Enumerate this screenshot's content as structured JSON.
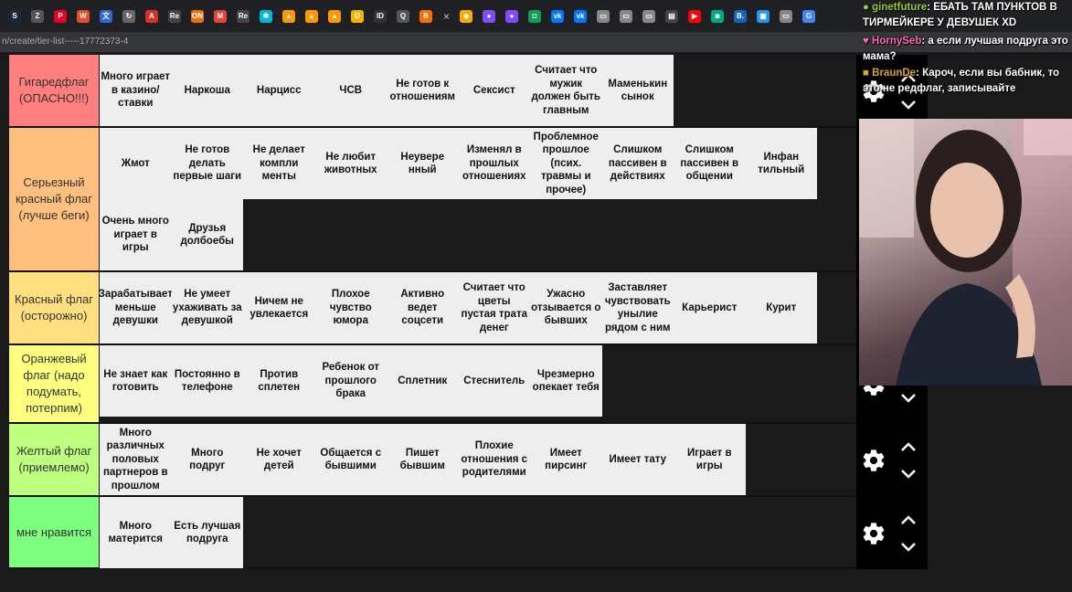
{
  "browser": {
    "tab_icons": [
      {
        "icon": "steam-icon",
        "color": "#1b2838",
        "glyph": "S"
      },
      {
        "icon": "zed-icon",
        "color": "#555555",
        "glyph": "Z"
      },
      {
        "icon": "pinterest-icon",
        "color": "#e60023",
        "glyph": "P"
      },
      {
        "icon": "w-icon",
        "color": "#e44d26",
        "glyph": "W"
      },
      {
        "icon": "translate-icon",
        "color": "#3367d6",
        "glyph": "文"
      },
      {
        "icon": "history-icon",
        "color": "#666666",
        "glyph": "↻"
      },
      {
        "icon": "a-icon",
        "color": "#d93025",
        "glyph": "A"
      },
      {
        "icon": "re-icon",
        "color": "#444444",
        "glyph": "Re"
      },
      {
        "icon": "orange-icon",
        "color": "#e8710a",
        "glyph": "ON"
      },
      {
        "icon": "gmail-icon",
        "color": "#ea4335",
        "glyph": "M"
      },
      {
        "icon": "re2-icon",
        "color": "#444444",
        "glyph": "Re"
      },
      {
        "icon": "star-icon",
        "color": "#00b8d9",
        "glyph": "✱"
      },
      {
        "icon": "fire-icon",
        "color": "#ff9800",
        "glyph": "▲"
      },
      {
        "icon": "fire2-icon",
        "color": "#ff9800",
        "glyph": "▲"
      },
      {
        "icon": "fire3-icon",
        "color": "#ff9800",
        "glyph": "▲"
      },
      {
        "icon": "d-icon",
        "color": "#f4b400",
        "glyph": "D"
      },
      {
        "icon": "id-icon",
        "color": "#333333",
        "glyph": "ID"
      },
      {
        "icon": "q-icon",
        "color": "#555555",
        "glyph": "Q"
      },
      {
        "icon": "b-icon",
        "color": "#ff6d00",
        "glyph": "B"
      }
    ],
    "tab_icons_right": [
      {
        "icon": "folder-icon",
        "color": "#f9ab00",
        "glyph": "◆"
      },
      {
        "icon": "globe-icon",
        "color": "#7c4dff",
        "glyph": "●"
      },
      {
        "icon": "globe2-icon",
        "color": "#7c4dff",
        "glyph": "●"
      },
      {
        "icon": "sheet-icon",
        "color": "#0f9d58",
        "glyph": "◘"
      },
      {
        "icon": "vk-icon",
        "color": "#0077ff",
        "glyph": "vk"
      },
      {
        "icon": "vk2-icon",
        "color": "#0077ff",
        "glyph": "vk"
      },
      {
        "icon": "page-icon",
        "color": "#888888",
        "glyph": "▭"
      },
      {
        "icon": "page2-icon",
        "color": "#888888",
        "glyph": "▭"
      },
      {
        "icon": "page3-icon",
        "color": "#888888",
        "glyph": "▭"
      },
      {
        "icon": "doc-icon",
        "color": "#444444",
        "glyph": "▤"
      },
      {
        "icon": "youtube-icon",
        "color": "#ff0000",
        "glyph": "▶"
      },
      {
        "icon": "chat-icon",
        "color": "#00a884",
        "glyph": "◙"
      },
      {
        "icon": "b2-icon",
        "color": "#1565c0",
        "glyph": "B."
      },
      {
        "icon": "img-icon",
        "color": "#2196f3",
        "glyph": "▣"
      },
      {
        "icon": "page4-icon",
        "color": "#888888",
        "glyph": "▭"
      },
      {
        "icon": "google-icon",
        "color": "#4285f4",
        "glyph": "G"
      }
    ],
    "address": "n/create/tier-list-----17772373-4"
  },
  "tiers": [
    {
      "label": "Гигаредфлаг (ОПАСНО!!!)",
      "color": "#ff7f7f",
      "height": 80,
      "items": [
        "Много играет в казино/ставки",
        "Наркоша",
        "Нарцисс",
        "ЧСВ",
        "Не готов к отношениям",
        "Сексист",
        "Считает что мужик должен быть главным",
        "Маменькин сынок"
      ]
    },
    {
      "label": "Серьезный красный флаг (лучше беги)",
      "color": "#ffbf7f",
      "height": 158,
      "items": [
        "Жмот",
        "Не готов делать первые шаги",
        "Не делает компли менты",
        "Не любит животных",
        "Неувере нный",
        "Изменял в прошлых отношениях",
        "Проблемное прошлое (псих. травмы и прочее)",
        "Слишком пассивен в действиях",
        "Слишком пассивен в общении",
        "Инфан тильный",
        "Очень много играет в игры",
        "Друзья долбоебы"
      ]
    },
    {
      "label": "Красный флаг (осторожно)",
      "color": "#ffdf7f",
      "height": 80,
      "items": [
        "Зарабатывает меньше девушки",
        "Не умеет ухаживать за девушкой",
        "Ничем не увлекается",
        "Плохое чувство юмора",
        "Активно ведет соцсети",
        "Считает что цветы пустая трата денег",
        "Ужасно отзывается о бывших",
        "Заставляет чувствовать унылие рядом с ним",
        "Карьерист",
        "Курит"
      ]
    },
    {
      "label": "Оранжевый флаг (надо подумать, потерпим)",
      "color": "#ffff7f",
      "height": 86,
      "items": [
        "Не знает как готовить",
        "Постоянно в телефоне",
        "Против сплетен",
        "Ребенок от прошлого брака",
        "Сплетник",
        "Стеснитель",
        "Чрезмерно опекает тебя"
      ]
    },
    {
      "label": "Желтый флаг (приемлемо)",
      "color": "#bfff7f",
      "height": 80,
      "items": [
        "Много различных половых партнеров в прошлом",
        "Много подруг",
        "Не хочет детей",
        "Общается с бывшими",
        "Пишет бывшим",
        "Плохие отношения с родителями",
        "Имеет пирсинг",
        "Имеет тату",
        "Играет в игры"
      ]
    },
    {
      "label": "мне нравится",
      "color": "#7fff7f",
      "height": 79,
      "items": [
        "Много матерится",
        "Есть лучшая подруга"
      ]
    }
  ],
  "chat": [
    {
      "user": "ginetfuture",
      "user_color": "#9acd32",
      "badge": "●",
      "message": "ЕБАТЬ ТАМ ПУНКТОВ В ТИРМЕЙКЕРЕ У ДЕВУШЕК XD"
    },
    {
      "user": "HornySeb",
      "user_color": "#ff69b4",
      "badge": "♥",
      "message": "а если лучшая подруга это мама?"
    },
    {
      "user": "BraunDe",
      "user_color": "#daa520",
      "badge": "■",
      "message": "Кароч, если вы бабник, то это не редфлаг, записывайте"
    }
  ],
  "colors": {
    "background": "#1a1a1a",
    "item_bg": "#eeeeee",
    "panel": "#000000"
  }
}
